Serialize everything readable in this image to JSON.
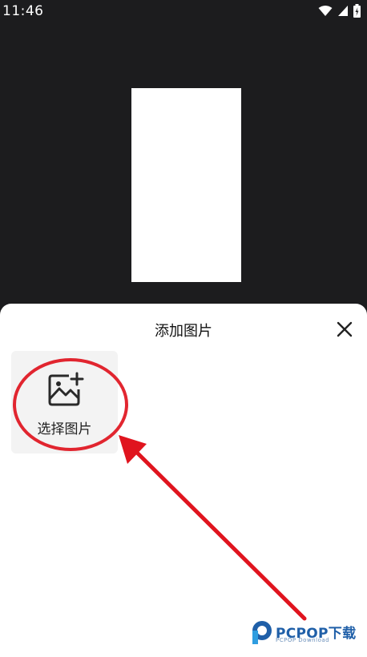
{
  "status_bar": {
    "time": "11:46",
    "icons": [
      "wifi-icon",
      "signal-icon",
      "battery-icon"
    ]
  },
  "sheet": {
    "title": "添加图片",
    "tile": {
      "label": "选择图片",
      "icon": "add-image-icon"
    },
    "close_icon": "close-icon"
  },
  "annotation": {
    "color": "#e0141e"
  },
  "watermark": {
    "brand": "PCPOP下载",
    "sub": "PCPOP Download"
  },
  "colors": {
    "background": "#1c1c1e",
    "sheet": "#ffffff",
    "tile": "#f3f3f3"
  }
}
